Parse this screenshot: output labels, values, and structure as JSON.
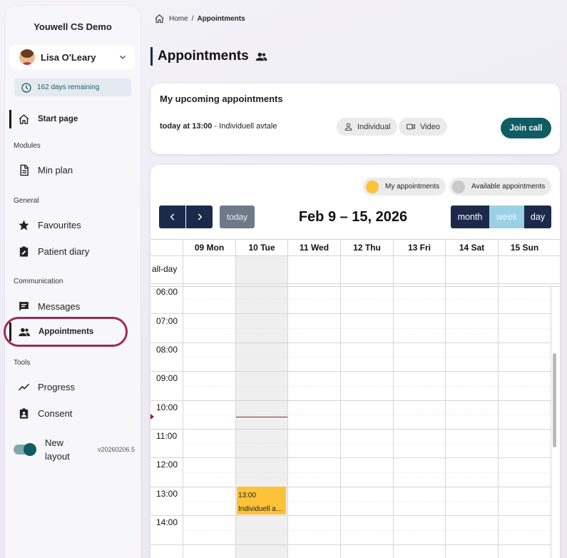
{
  "sidebar": {
    "org_name": "Youwell CS Demo",
    "user_name": "Lisa O'Leary",
    "days_remaining": "162 days remaining",
    "start_page": "Start page",
    "sections": {
      "modules": "Modules",
      "general": "General",
      "communication": "Communication",
      "tools": "Tools"
    },
    "items": {
      "min_plan": "Min plan",
      "favourites": "Favourites",
      "patient_diary": "Patient diary",
      "messages": "Messages",
      "appointments": "Appointments",
      "progress": "Progress",
      "consent": "Consent"
    },
    "layout_toggle": {
      "label": "New layout",
      "on": true
    },
    "version": "v20260206.5"
  },
  "breadcrumb": {
    "home": "Home",
    "separator": "/",
    "current": "Appointments"
  },
  "page_title": "Appointments",
  "upcoming": {
    "title": "My upcoming appointments",
    "when": "today at 13:00",
    "description": " - Individuell avtale",
    "chip_type": "Individual",
    "chip_mode": "Video",
    "join_label": "Join call"
  },
  "calendar": {
    "legend": {
      "mine": "My appointments",
      "available": "Available appointments",
      "mine_color": "#fcc23a",
      "available_color": "#c9c9cb"
    },
    "today_label": "today",
    "range_title": "Feb 9 – 15, 2026",
    "views": {
      "month": "month",
      "week": "week",
      "day": "day",
      "active": "week"
    },
    "days": [
      "09 Mon",
      "10 Tue",
      "11 Wed",
      "12 Thu",
      "13 Fri",
      "14 Sat",
      "15 Sun"
    ],
    "allday_label": "all-day",
    "times": [
      "06:00",
      "07:00",
      "08:00",
      "09:00",
      "10:00",
      "11:00",
      "12:00",
      "13:00",
      "14:00"
    ],
    "event": {
      "time": "13:00",
      "title": "Individuell avtale"
    }
  },
  "colors": {
    "accent": "#0f5d63",
    "nav_dark": "#1b2a4a",
    "highlight": "#9b2c57"
  }
}
